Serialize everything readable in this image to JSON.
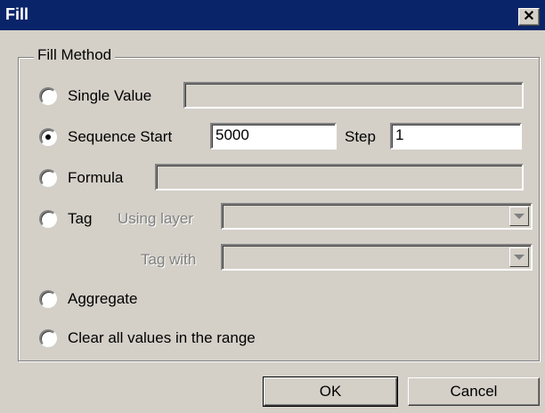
{
  "window": {
    "title": "Fill",
    "close_glyph": "✕"
  },
  "group": {
    "legend": "Fill Method"
  },
  "options": {
    "single_value": {
      "label": "Single Value",
      "checked": false,
      "value": ""
    },
    "sequence": {
      "label": "Sequence Start",
      "checked": true,
      "start_value": "5000",
      "step_label": "Step",
      "step_value": "1"
    },
    "formula": {
      "label": "Formula",
      "checked": false,
      "value": ""
    },
    "tag": {
      "label": "Tag",
      "checked": false,
      "using_layer_label": "Using layer",
      "using_layer_value": "",
      "tag_with_label": "Tag with",
      "tag_with_value": ""
    },
    "aggregate": {
      "label": "Aggregate",
      "checked": false
    },
    "clear": {
      "label": "Clear all values in the range",
      "checked": false
    }
  },
  "buttons": {
    "ok": "OK",
    "cancel": "Cancel"
  }
}
